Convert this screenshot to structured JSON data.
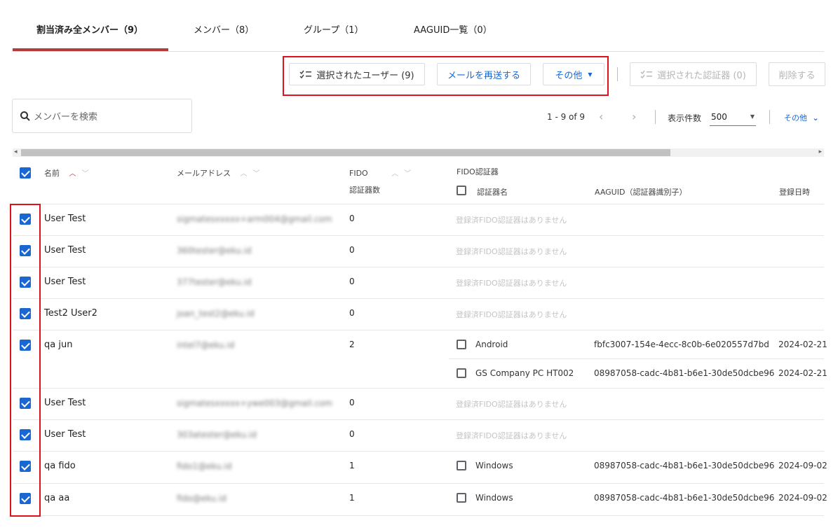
{
  "tabs": [
    {
      "label": "割当済み全メンバー（9）",
      "active": true
    },
    {
      "label": "メンバー（8）",
      "active": false
    },
    {
      "label": "グループ（1）",
      "active": false
    },
    {
      "label": "AAGUID一覧（0）",
      "active": false
    }
  ],
  "toolbar": {
    "selected_users_label": "選択されたユーザー (9)",
    "resend_mail_label": "メールを再送する",
    "more_label": "その他",
    "selected_authenticators_label": "選択された認証器 (0)",
    "delete_label": "削除する"
  },
  "search": {
    "placeholder": "メンバーを検索"
  },
  "pagination": {
    "range": "1 - 9 of 9",
    "per_page_label": "表示件数",
    "per_page_value": "500",
    "more_label": "その他"
  },
  "table": {
    "headers": {
      "name": "名前",
      "email": "メールアドレス",
      "fido_line1": "FIDO",
      "fido_line2": "認証器数",
      "fido_auth": "FIDO認証器",
      "auth_name": "認証器名",
      "aaguid": "AAGUID（認証器識別子）",
      "registered": "登録日時"
    },
    "no_authenticators_text": "登録済FIDO認証器はありません",
    "rows": [
      {
        "name": "User Test",
        "email": "sigmatesxxxxx+arm004@gmail.com",
        "count": "0"
      },
      {
        "name": "User Test",
        "email": "360tester@eku.id",
        "count": "0"
      },
      {
        "name": "User Test",
        "email": "377tester@eku.id",
        "count": "0"
      },
      {
        "name": "Test2 User2",
        "email": "joan_test2@eku.id",
        "count": "0"
      },
      {
        "name": "qa jun",
        "email": "intel7@eku.id",
        "count": "2",
        "authenticators": [
          {
            "name": "Android",
            "aaguid": "fbfc3007-154e-4ecc-8c0b-6e020557d7bd",
            "date": "2024-02-21"
          },
          {
            "name": "GS Company PC HT002",
            "aaguid": "08987058-cadc-4b81-b6e1-30de50dcbe96",
            "date": "2024-02-21"
          }
        ]
      },
      {
        "name": "User Test",
        "email": "sigmatesxxxxx+ywe003@gmail.com",
        "count": "0"
      },
      {
        "name": "User Test",
        "email": "303atester@eku.id",
        "count": "0"
      },
      {
        "name": "qa fido",
        "email": "fido1@eku.id",
        "count": "1",
        "authenticators": [
          {
            "name": "Windows",
            "aaguid": "08987058-cadc-4b81-b6e1-30de50dcbe96",
            "date": "2024-09-02"
          }
        ]
      },
      {
        "name": "qa aa",
        "email": "fido@eku.id",
        "count": "1",
        "authenticators": [
          {
            "name": "Windows",
            "aaguid": "08987058-cadc-4b81-b6e1-30de50dcbe96",
            "date": "2024-09-02"
          }
        ]
      }
    ]
  },
  "colors": {
    "accent": "#1a67d2",
    "tab_underline": "#b23b3b",
    "highlight": "#e0101c"
  }
}
